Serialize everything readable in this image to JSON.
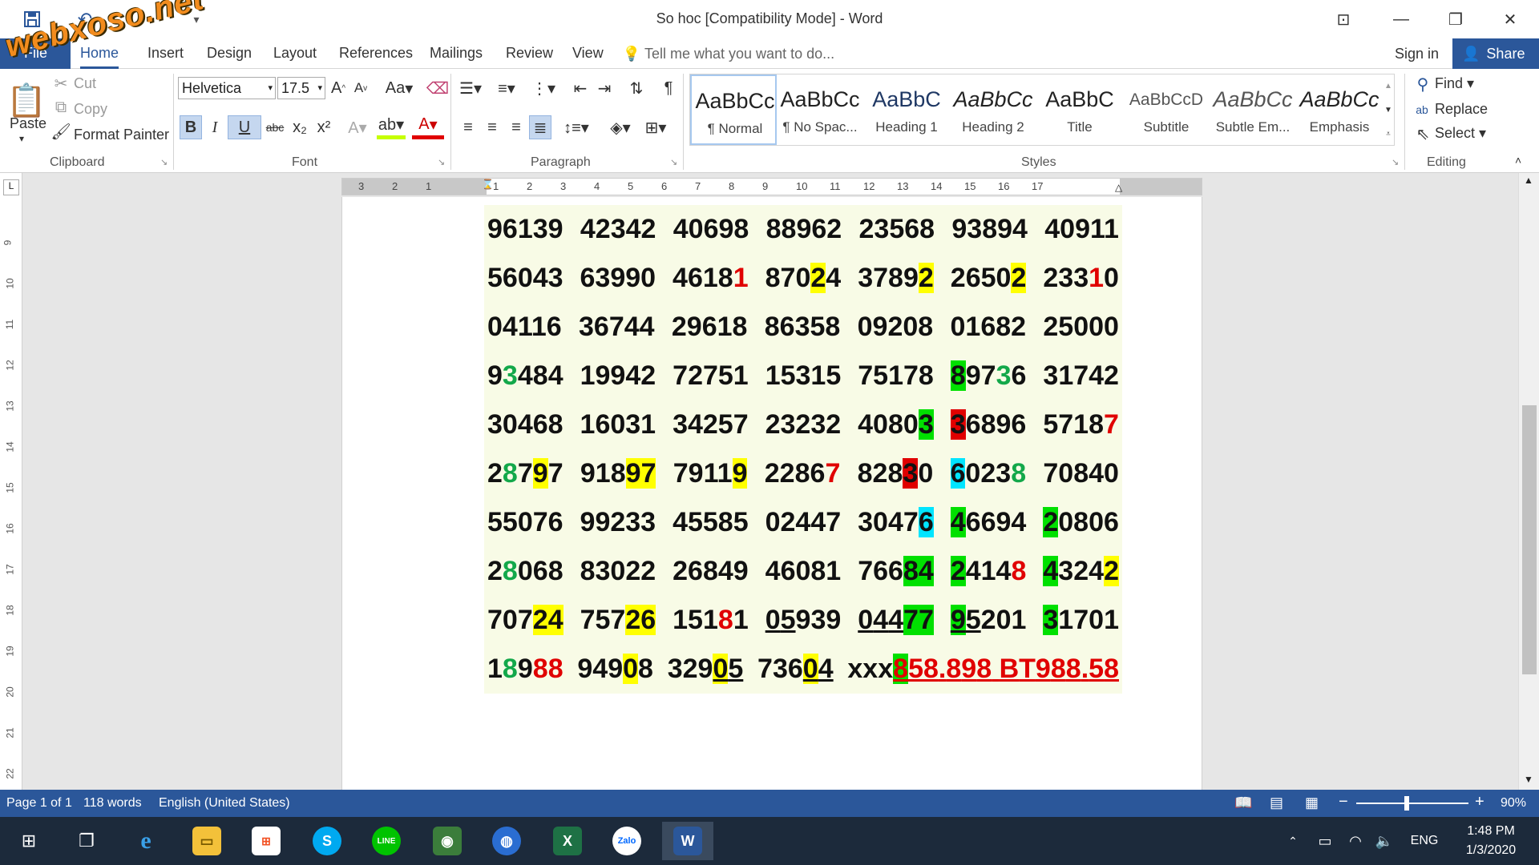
{
  "window": {
    "title": "So hoc [Compatibility Mode] - Word",
    "logo": "webxoso.net"
  },
  "quick_access": {
    "save": "save-icon",
    "undo": "undo-icon",
    "customize": "customize-icon"
  },
  "tabs": {
    "file": "File",
    "home": "Home",
    "insert": "Insert",
    "design": "Design",
    "layout": "Layout",
    "references": "References",
    "mailings": "Mailings",
    "review": "Review",
    "view": "View",
    "tell_me": "Tell me what you want to do...",
    "sign_in": "Sign in",
    "share": "Share"
  },
  "clipboard": {
    "paste": "Paste",
    "cut": "Cut",
    "copy": "Copy",
    "format_painter": "Format Painter",
    "label": "Clipboard"
  },
  "font": {
    "name": "Helvetica",
    "size": "17.5",
    "label": "Font",
    "case": "Aa",
    "bold": "B",
    "italic": "I",
    "underline": "U",
    "strike": "abc",
    "sub": "x₂",
    "sup": "x²",
    "color": "A"
  },
  "paragraph": {
    "label": "Paragraph"
  },
  "styles": {
    "label": "Styles",
    "items": [
      {
        "preview": "AaBbCc",
        "name": "¶ Normal"
      },
      {
        "preview": "AaBbCc",
        "name": "¶ No Spac..."
      },
      {
        "preview": "AaBbC",
        "name": "Heading 1"
      },
      {
        "preview": "AaBbCc",
        "name": "Heading 2"
      },
      {
        "preview": "AaBbC",
        "name": "Title"
      },
      {
        "preview": "AaBbCcD",
        "name": "Subtitle"
      },
      {
        "preview": "AaBbCc",
        "name": "Subtle Em..."
      },
      {
        "preview": "AaBbCc",
        "name": "Emphasis"
      }
    ]
  },
  "editing": {
    "find": "Find",
    "replace": "Replace",
    "select": "Select",
    "label": "Editing"
  },
  "ruler": {
    "h_numbers": [
      "3",
      "2",
      "1",
      "1",
      "2",
      "3",
      "4",
      "5",
      "6",
      "7",
      "8",
      "9",
      "10",
      "11",
      "12",
      "13",
      "14",
      "15",
      "16",
      "17"
    ],
    "v_numbers": [
      "9",
      "10",
      "11",
      "12",
      "13",
      "14",
      "15",
      "16",
      "17",
      "18",
      "19",
      "20",
      "21",
      "22"
    ]
  },
  "document": {
    "rows": [
      [
        "96139",
        "42342",
        "40698",
        "88962",
        "23568",
        "93894",
        "40911"
      ],
      [
        "56043",
        "63990",
        "46181",
        "87024",
        "37892",
        "26502",
        "23310"
      ],
      [
        "04116",
        "36744",
        "29618",
        "86358",
        "09208",
        "01682",
        "25000"
      ],
      [
        "93484",
        "19942",
        "72751",
        "15315",
        "75178",
        "89736",
        "31742"
      ],
      [
        "30468",
        "16031",
        "34257",
        "23232",
        "40803",
        "36896",
        "57187"
      ],
      [
        "28797",
        "91897",
        "79119",
        "22867",
        "82830",
        "60238",
        "70840"
      ],
      [
        "55076",
        "99233",
        "45585",
        "02447",
        "30476",
        "46694",
        "20806"
      ],
      [
        "28068",
        "83022",
        "26849",
        "46081",
        "76684",
        "24148",
        "43242"
      ],
      [
        "70724",
        "75726",
        "15181",
        "05939",
        "04477",
        "95201",
        "31701"
      ],
      [
        "18988",
        "94908",
        "32905",
        "73604",
        "xxx858.898 BT988.58"
      ]
    ]
  },
  "status": {
    "page": "Page 1 of 1",
    "words": "118 words",
    "language": "English (United States)",
    "zoom": "90%"
  },
  "taskbar": {
    "time": "1:48 PM",
    "date": "1/3/2020",
    "lang": "ENG",
    "apps": [
      "start-icon",
      "task-view-icon",
      "edge-icon",
      "explorer-icon",
      "store-icon",
      "skype-icon",
      "line-icon",
      "chrome-icon",
      "globe-icon",
      "excel-icon",
      "zalo-icon",
      "word-icon"
    ]
  }
}
